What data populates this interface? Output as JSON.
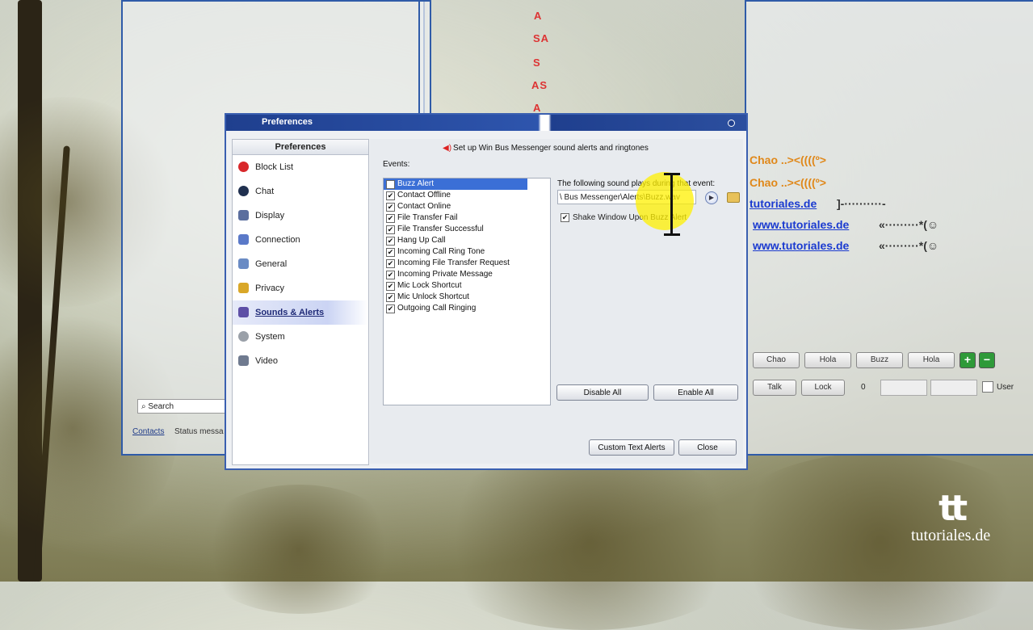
{
  "dialog": {
    "title": "Preferences",
    "sidebar_title": "Preferences",
    "sidebar_items": [
      {
        "label": "Block List",
        "color": "#d8272b"
      },
      {
        "label": "Chat",
        "color": "#20304f"
      },
      {
        "label": "Display",
        "color": "#5b6e9e"
      },
      {
        "label": "Connection",
        "color": "#5a79c8"
      },
      {
        "label": "General",
        "color": "#6a8bc4"
      },
      {
        "label": "Privacy",
        "color": "#d9a728"
      },
      {
        "label": "Sounds & Alerts",
        "color": "#5e4fa6"
      },
      {
        "label": "System",
        "color": "#9aa0a8"
      },
      {
        "label": "Video",
        "color": "#6f7a8f"
      }
    ],
    "active_item": "Sounds & Alerts",
    "header_text": "Set up Win Bus Messenger sound alerts and ringtones",
    "events_label": "Events:",
    "events": [
      {
        "label": "Buzz Alert",
        "checked": false,
        "selected": true
      },
      {
        "label": "Contact Offline",
        "checked": true
      },
      {
        "label": "Contact Online",
        "checked": true
      },
      {
        "label": "File Transfer Fail",
        "checked": true
      },
      {
        "label": "File Transfer Successful",
        "checked": true
      },
      {
        "label": "Hang Up Call",
        "checked": true
      },
      {
        "label": "Incoming Call Ring Tone",
        "checked": true
      },
      {
        "label": "Incoming File Transfer Request",
        "checked": true
      },
      {
        "label": "Incoming Private Message",
        "checked": true
      },
      {
        "label": "Mic Lock Shortcut",
        "checked": true
      },
      {
        "label": "Mic Unlock Shortcut",
        "checked": true
      },
      {
        "label": "Outgoing Call Ringing",
        "checked": true
      }
    ],
    "sound_label": "The following sound plays during that event:",
    "sound_path": "\\ Bus Messenger\\Alerts\\Buzz.wav",
    "shake_label": "Shake Window Upon Buzz Alert",
    "shake_checked": true,
    "disable_all": "Disable All",
    "enable_all": "Enable All",
    "custom_text_alerts": "Custom Text Alerts",
    "close": "Close"
  },
  "background": {
    "search_label": "Search",
    "contacts_tab": "Contacts",
    "status_tab": "Status messa",
    "red_letters": [
      "A",
      "SA",
      "S",
      "AS",
      "A"
    ],
    "chat_lines": [
      {
        "text": "Chao ..><((((º>",
        "style": "orange"
      },
      {
        "text": "Chao ..><((((º>",
        "style": "orange"
      },
      {
        "text": "tutoriales.de",
        "style": "blue"
      },
      {
        "text": "]-··········-",
        "style": "dash"
      },
      {
        "text": "www.tutoriales.de",
        "style": "blue"
      },
      {
        "text": "«·········*(☺",
        "style": "dash"
      },
      {
        "text": "www.tutoriales.de",
        "style": "blue"
      },
      {
        "text": "«·········*(☺",
        "style": "dash"
      }
    ],
    "buttons": [
      "Chao",
      "Hola",
      "Buzz",
      "Hola",
      "Talk",
      "Lock"
    ],
    "counter": "0",
    "user_label": "User"
  },
  "watermark": {
    "mark": "tt",
    "text": "tutoriales.de"
  }
}
